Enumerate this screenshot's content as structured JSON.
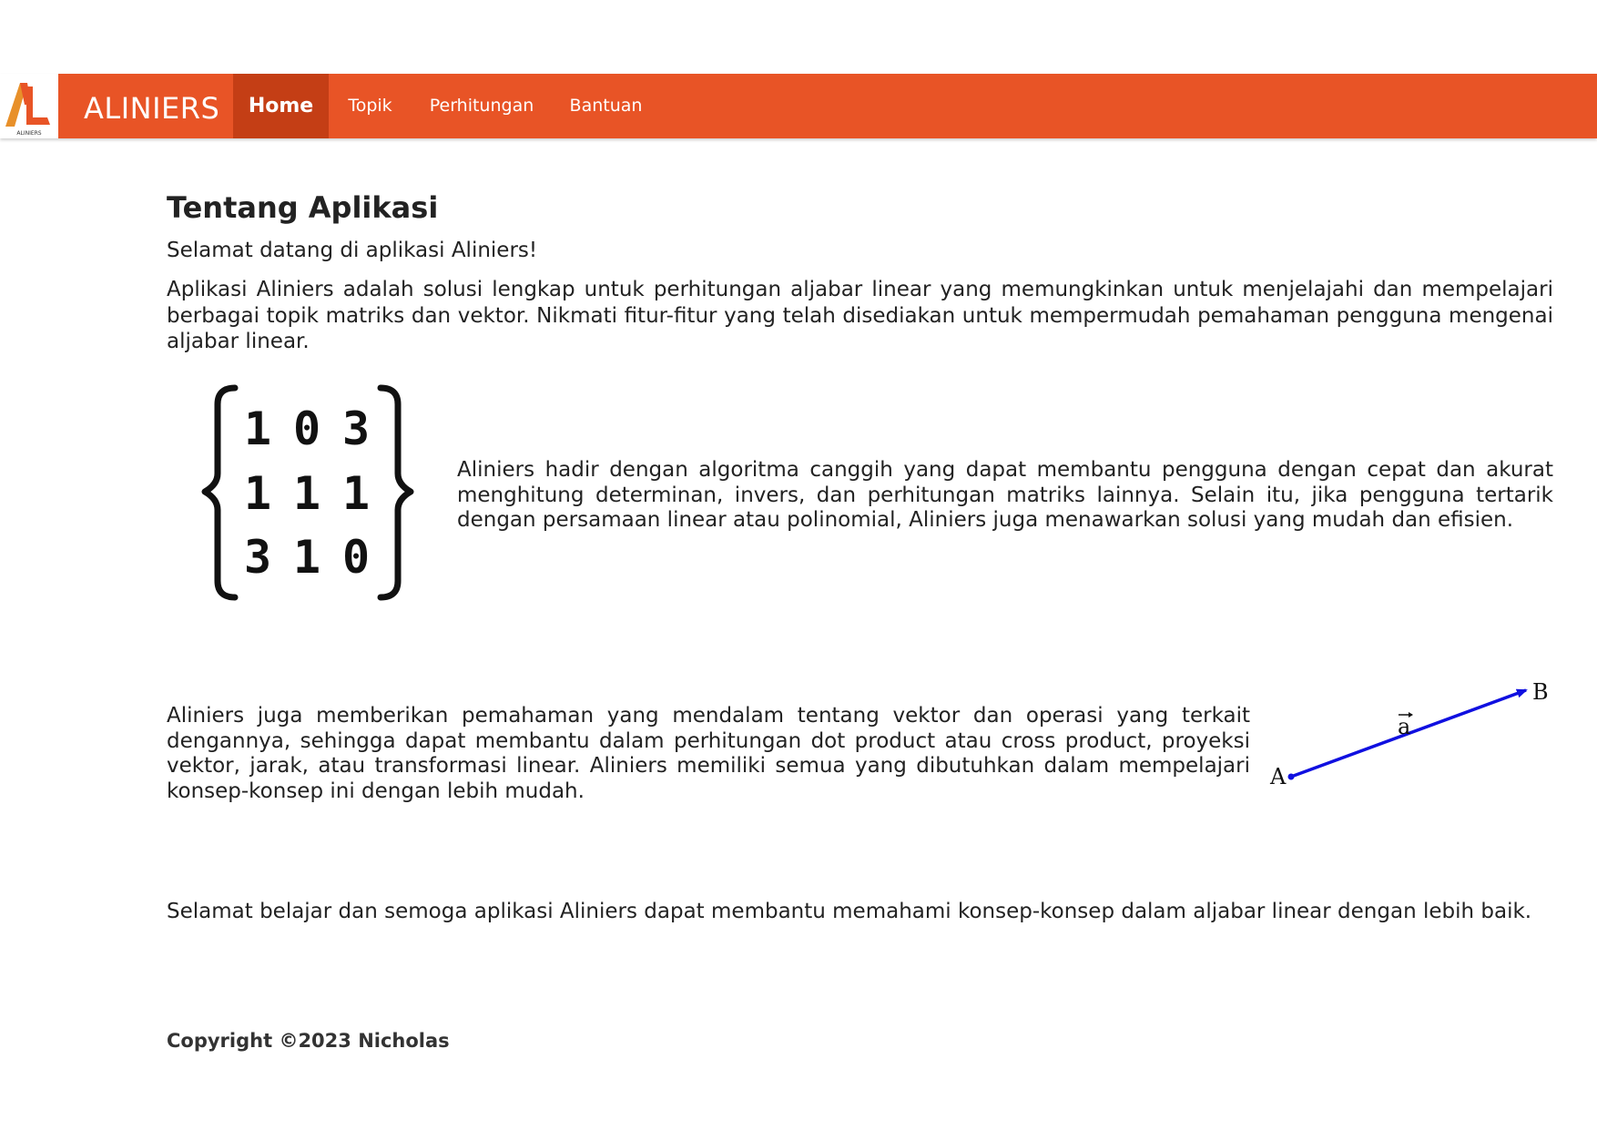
{
  "theme": {
    "nav_color": "#e85426",
    "nav_active_color": "#c43e15",
    "vector_color": "#1010e0"
  },
  "navbar": {
    "logo_icon": "aliniers-logo-icon",
    "logo_small_text": "ALINIERS",
    "brand": "ALINIERS",
    "items": [
      {
        "label": "Home",
        "active": true
      },
      {
        "label": "Topik",
        "active": false
      },
      {
        "label": "Perhitungan",
        "active": false
      },
      {
        "label": "Bantuan",
        "active": false
      }
    ]
  },
  "main": {
    "title": "Tentang Aplikasi",
    "welcome": "Selamat datang di aplikasi Aliniers!",
    "intro": "Aplikasi Aliniers adalah solusi lengkap untuk perhitungan aljabar linear yang memungkinkan untuk menjelajahi dan mempelajari berbagai topik matriks dan vektor. Nikmati fitur-fitur yang telah disediakan untuk mempermudah pemahaman pengguna mengenai aljabar linear.",
    "matrix_figure": {
      "icon": "matrix-braces-icon",
      "rows": [
        [
          "1",
          "0",
          "3"
        ],
        [
          "1",
          "1",
          "1"
        ],
        [
          "3",
          "1",
          "0"
        ]
      ]
    },
    "matrix_paragraph": "Aliniers hadir dengan algoritma canggih yang dapat membantu pengguna dengan cepat dan akurat menghitung determinan, invers, dan perhitungan matriks lainnya. Selain itu, jika pengguna tertarik dengan persamaan linear atau polinomial, Aliniers juga menawarkan solusi yang mudah dan efisien.",
    "vector_paragraph": "Aliniers juga memberikan pemahaman yang mendalam tentang vektor dan operasi yang terkait dengannya, sehingga dapat membantu dalam perhitungan dot product atau cross product, proyeksi vektor, jarak, atau transformasi linear. Aliniers memiliki semua yang dibutuhkan dalam mempelajari konsep-konsep ini dengan lebih mudah.",
    "vector_figure": {
      "icon": "vector-arrow-icon",
      "start_label": "A",
      "end_label": "B",
      "vector_label": "a"
    },
    "closing": "Selamat belajar dan semoga aplikasi Aliniers dapat membantu memahami konsep-konsep dalam aljabar linear dengan lebih baik."
  },
  "footer": {
    "copyright": "Copyright ©2023 Nicholas"
  }
}
